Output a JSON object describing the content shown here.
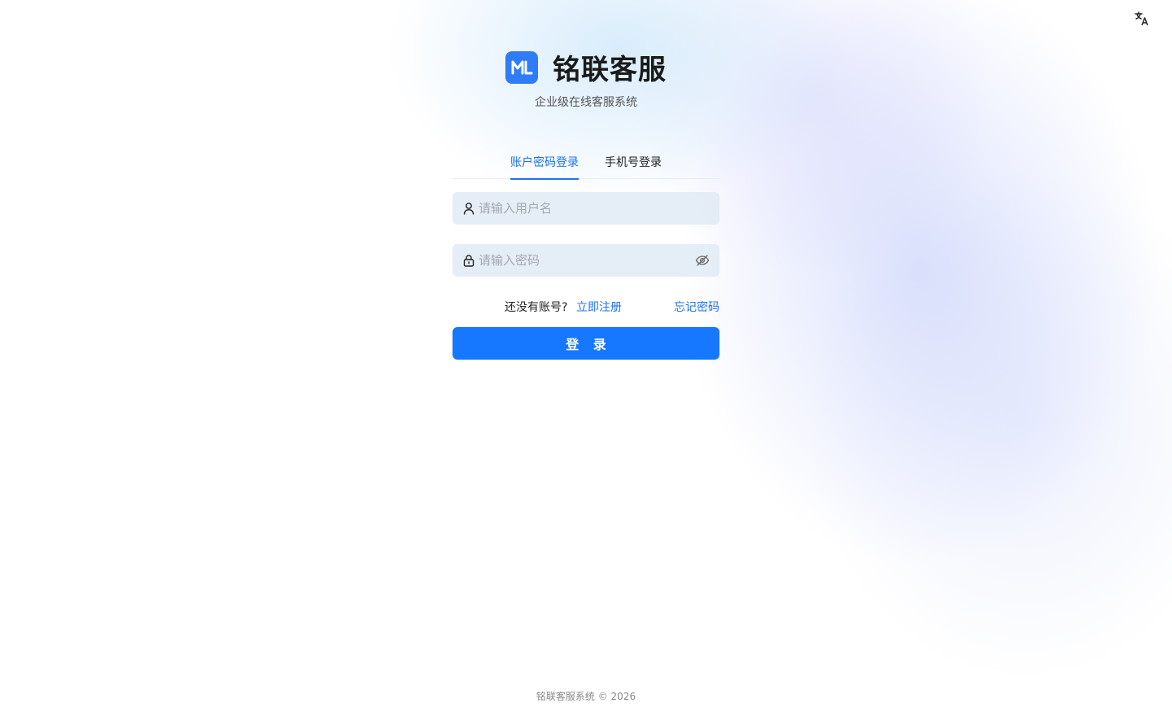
{
  "header": {
    "language_icon": "translate-icon"
  },
  "brand": {
    "logo_icon": "ml-logo",
    "logo_text": "ML",
    "title": "铭联客服",
    "subtitle": "企业级在线客服系统"
  },
  "tabs": [
    {
      "label": "账户密码登录",
      "active": true
    },
    {
      "label": "手机号登录",
      "active": false
    }
  ],
  "form": {
    "username": {
      "placeholder": "请输入用户名",
      "value": "",
      "icon": "user-icon"
    },
    "password": {
      "placeholder": "请输入密码",
      "value": "",
      "icon": "lock-icon",
      "toggle_icon": "eye-off-icon"
    },
    "no_account_text": "还没有账号?",
    "register_link": "立即注册",
    "forgot_link": "忘记密码",
    "submit_label": "登 录"
  },
  "footer": {
    "copyright": "铭联客服系统 © 2026"
  },
  "colors": {
    "accent": "#1677ff",
    "link": "#1e72f0",
    "logo_bg": "#2f7cf6"
  }
}
